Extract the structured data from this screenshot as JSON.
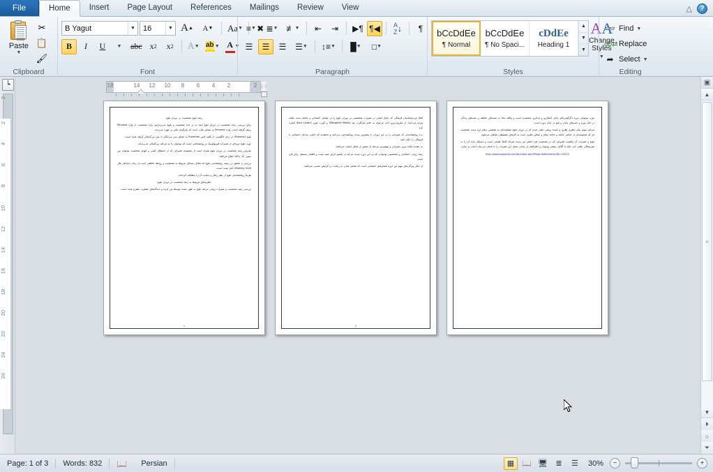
{
  "window": {
    "tabs": [
      {
        "label": "File",
        "active": false,
        "kind": "file"
      },
      {
        "label": "Home",
        "active": true
      },
      {
        "label": "Insert",
        "active": false
      },
      {
        "label": "Page Layout",
        "active": false
      },
      {
        "label": "References",
        "active": false
      },
      {
        "label": "Mailings",
        "active": false
      },
      {
        "label": "Review",
        "active": false
      },
      {
        "label": "View",
        "active": false
      }
    ],
    "help_label": "?",
    "minimize_ribbon_icon": "chevron-up-icon"
  },
  "ribbon": {
    "clipboard": {
      "label": "Clipboard",
      "paste_label": "Paste",
      "cut_icon": "scissors-icon",
      "copy_icon": "copy-icon",
      "format_painter_icon": "paintbrush-icon",
      "launcher": "dialog-launcher"
    },
    "font": {
      "label": "Font",
      "font_name": "B Yagut",
      "font_size": "16",
      "grow_font": "A",
      "shrink_font": "A",
      "change_case": "Aa",
      "clear_formatting": "clear-formatting-icon",
      "bold": "B",
      "italic": "I",
      "underline": "U",
      "strikethrough": "abc",
      "subscript": "x",
      "superscript": "x",
      "text_effects": "A",
      "highlight": "ab",
      "font_color": "A",
      "launcher": "dialog-launcher"
    },
    "paragraph": {
      "label": "Paragraph",
      "bullets": "bullets-icon",
      "numbering": "numbering-icon",
      "multilevel": "multilevel-list-icon",
      "decrease_indent": "decrease-indent-icon",
      "increase_indent": "increase-indent-icon",
      "ltr_text": "left-to-right-icon",
      "rtl_text": "right-to-left-icon",
      "sort": "sort-icon",
      "show_marks": "pilcrow-icon",
      "align_left": "align-left-icon",
      "align_center": "align-center-icon",
      "align_right": "align-right-icon",
      "justify": "justify-icon",
      "line_spacing": "line-spacing-icon",
      "shading": "shading-icon",
      "borders": "borders-icon",
      "launcher": "dialog-launcher"
    },
    "styles": {
      "label": "Styles",
      "items": [
        {
          "preview": "bCcDdEe",
          "name": "¶ Normal",
          "selected": true
        },
        {
          "preview": "bCcDdEe",
          "name": "¶ No Spaci...",
          "selected": false
        },
        {
          "preview": "cDdEe",
          "name": "Heading 1",
          "selected": false
        }
      ],
      "change_styles_label_1": "Change",
      "change_styles_label_2": "Styles",
      "launcher": "dialog-launcher"
    },
    "editing": {
      "label": "Editing",
      "find": "Find",
      "replace": "Replace",
      "select": "Select",
      "find_icon": "binoculars-icon",
      "replace_icon": "replace-icon",
      "select_icon": "cursor-arrow-icon"
    }
  },
  "rulers": {
    "horizontal": [
      "18",
      "14",
      "12",
      "10",
      "8",
      "6",
      "4",
      "2",
      "2"
    ],
    "vertical": [
      "2",
      "2",
      "4",
      "6",
      "8",
      "10",
      "12",
      "14",
      "16",
      "18",
      "20",
      "22",
      "24",
      "26"
    ],
    "corner_tab_icon": "tab-left-icon"
  },
  "document": {
    "pages": [
      {
        "number": "1",
        "paragraphs": [
          {
            "text": "رشد بلوغ شخصیت در دوران بلوغ",
            "center": true
          },
          {
            "text": "برای بررسی رشد شخصیت در دوران بلوغ ابتدا به در دانه شخصیت و بلوغ می‌پردازیم، واژه شخصیت از واژه Persona ریشه گرفته است. واژه Persona به معنای نقاب است که بازیگران تئاتر بر چهره می‌زدند."
          },
          {
            "text": "بلوغ (Puberty) در زبان انگلیسی از کلمه لاتین Pubertas به معنای سن مردانگی یا سن بزرگسالی گرفته شده است.",
            "highlight": "Pubertas"
          },
          {
            "text": "دوره بلوغ دوره‌ای از تغییرات فیزیولوژیک و روانشناختی است که نوجوان را به مرحله بزرگسالی می‌رساند."
          },
          {
            "text": "بنابراین رشد شخصیت در دوران بلوغ همراه است از مجموعه تغییراتی که از استقلال کسی و کهدی شخصیت نوجوان بین سنین 12 تا 18 اتفاق می‌افتد."
          },
          {
            "text": "بررسی و تحقیق در زمینه روانشناسی بلوغ که شامل مسائل مربوط به شخصیت و روابط عاطفی است از زمان استانلی هال (Stanley hall) آغاز شده است."
          },
          {
            "text": "تقریباً روانشناسان بلوغ از نظر رفتار و معایب آن را مطالعه کرده‌اند.",
            "center": false
          },
          {
            "text": "نظریه‌های مربوط به رشد شخصیت در دوران بلوغ",
            "center": true
          },
          {
            "text": "بررسی رشد شخصیت و تغییرات روانی مرحله بلوغ به طور عمده توسط من کرده و دیدگاه‌های متفاوت مطرح شده است."
          }
        ]
      },
      {
        "number": "2",
        "paragraphs": [
          {
            "text": "الفا) مردم‌شناسان فرهنگی که عامل اصلی در تغییرات شخصیتی در دوران بلوغ را در عوامل اجتماعی و عامله سنت عقاید مردم می‌دانند. از معروف‌ترین آنان می‌توان به خانم مارگارت مید (Margaret Mead) و کورت لوین (Kurt Lewin) اشاره کرد."
          },
          {
            "text": "ب) روانشناسانی که تغییراتی را در این دوران با بیشترین پدیده روانشناختی می‌دانند و معتقدند که دائمی مراحل اجتماعی با فرهنگی را انکار کنند."
          },
          {
            "text": "به عقیده لیکت ترین تغییراتی و مهم‌ترین مرحله از بخش در شکل انسان می‌باشد."
          },
          {
            "text": "رشد روانی اجتماعی و شخصیتی نوجوانی که در این دوره پدیده می‌آید از یکسو دارای جنبه مثبت و افقدار مستقل برای فرد است."
          },
          {
            "text": "از دیگر ویژگی‌های مهم این دوره هنجارهای اجتماعی است که شامل شدن به رعایت در گرایش جنسی می‌باشد."
          }
        ]
      },
      {
        "number": "3",
        "paragraphs": [
          {
            "text": "دوره نوجوانی دوره دگرگونی‌های پایان، آشکاری و پایداری شخصیت است و واقف مانا به جنبه‌های عاطفه و جنبه‌های زندگی در اغاز دوره و جنبه‌های پایدار و تابع در پایان دوره است."
          },
          {
            "text": "مرحله سوم نیکی نظری نظری و امیده روشی مثلی است که در دوران بلوغ مشاهده‌ای به همچنین سلام نرخ بست شخصیت ای که مجموعه‌ای از عناصر عامله و عادله سلام و ممکن نظری است به کارهای مشفوقی تشکیل می‌شود."
          },
          {
            "text": "بلوغ و تغییرات آن واقعیت تغییراتی که در شخصیت فرد اتفاق این پدیده صرائه کاملاً طبیعی است و دستکار نباید آن را به هم‌ریختگی طلبی کرد بلکه با آگاهی بیشتر نوجوان و اطرافیان از میدان تحمل این تغییرات را تا تابعان به‌رسان آسان تر سازد."
          },
          {
            "text": "http://www.pajooha.com/fa/index.php?Page-definition&UID=22012",
            "link": true
          }
        ]
      }
    ]
  },
  "statusbar": {
    "page": "Page: 1 of 3",
    "words": "Words: 832",
    "proofing_icon": "spelling-check-icon",
    "language": "Persian",
    "view_buttons": [
      {
        "icon": "print-layout-icon",
        "name": "print-layout",
        "active": true
      },
      {
        "icon": "full-screen-reading-icon",
        "name": "full-screen-reading",
        "active": false
      },
      {
        "icon": "web-layout-icon",
        "name": "web-layout",
        "active": false
      },
      {
        "icon": "outline-icon",
        "name": "outline",
        "active": false
      },
      {
        "icon": "draft-icon",
        "name": "draft",
        "active": false
      }
    ],
    "zoom": "30%",
    "zoom_out": "−",
    "zoom_in": "+"
  },
  "scrollbar": {
    "split_icon": "split-window-icon",
    "up_icon": "scroll-up-icon",
    "down_icon": "scroll-down-icon",
    "prev_page_icon": "previous-page-icon",
    "browse_object_icon": "select-browse-object-icon",
    "next_page_icon": "next-page-icon"
  }
}
